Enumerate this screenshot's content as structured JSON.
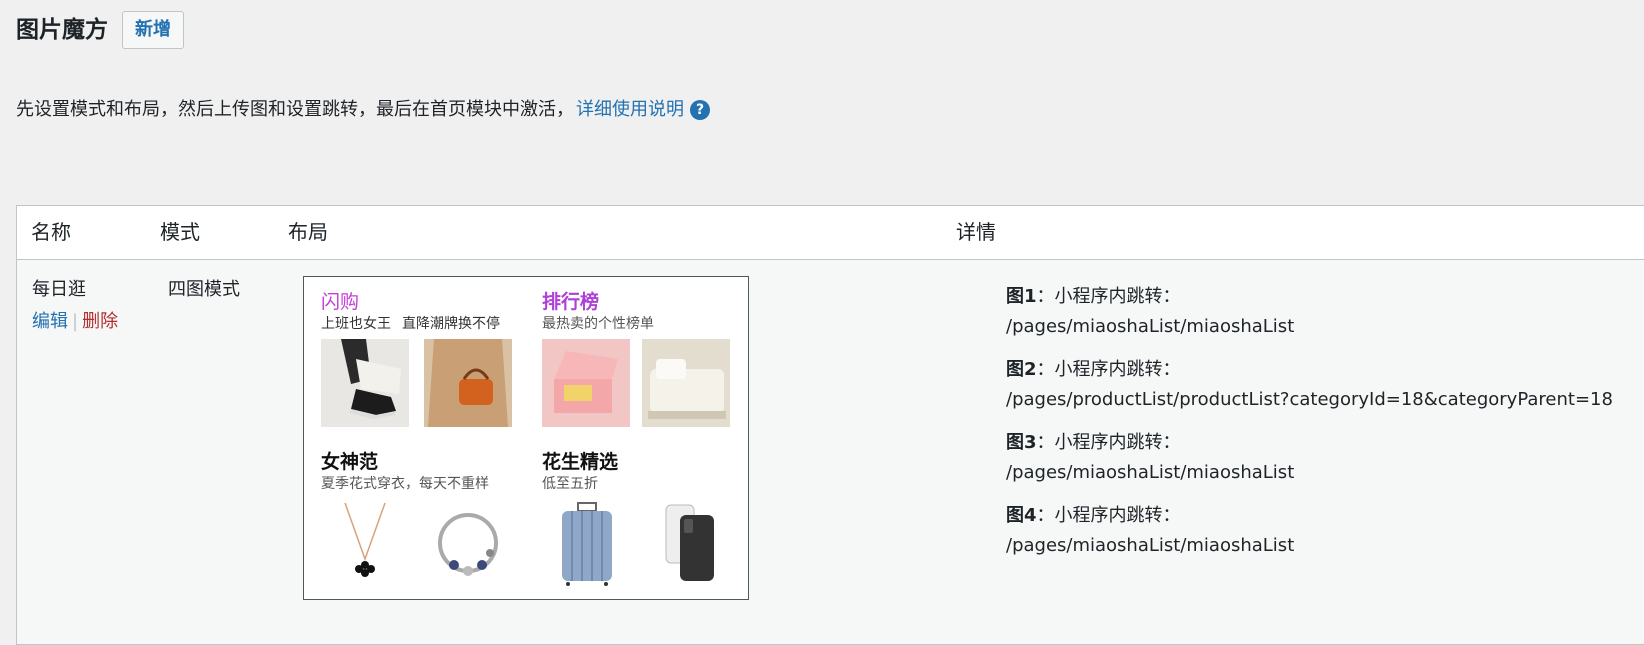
{
  "header": {
    "title": "图片魔方",
    "add_label": "新增"
  },
  "intro": {
    "text": "先设置模式和布局，然后上传图和设置跳转，最后在首页模块中激活，",
    "link": "详细使用说明",
    "help_icon": "?"
  },
  "table": {
    "columns": {
      "name": "名称",
      "mode": "模式",
      "layout": "布局",
      "detail": "详情"
    },
    "row": {
      "name": "每日逛",
      "edit": "编辑",
      "separator": "|",
      "delete": "删除",
      "mode": "四图模式",
      "layout": {
        "q1": {
          "title": "闪购",
          "sub1": "上班也女王",
          "sub2": "直降潮牌换不停",
          "color": "#c53fd6"
        },
        "q2": {
          "title": "排行榜",
          "sub": "最热卖的个性榜单",
          "color": "#b03ed8"
        },
        "q3": {
          "title": "女神范",
          "sub": "夏季花式穿衣，每天不重样"
        },
        "q4": {
          "title": "花生精选",
          "sub": "低至五折"
        }
      },
      "details": [
        {
          "label": "图1",
          "type": "：小程序内跳转：",
          "path": "/pages/miaoshaList/miaoshaList"
        },
        {
          "label": "图2",
          "type": "：小程序内跳转：",
          "path": "/pages/productList/productList?categoryId=18&categoryParent=18"
        },
        {
          "label": "图3",
          "type": "：小程序内跳转：",
          "path": "/pages/miaoshaList/miaoshaList"
        },
        {
          "label": "图4",
          "type": "：小程序内跳转：",
          "path": "/pages/miaoshaList/miaoshaList"
        }
      ]
    }
  }
}
